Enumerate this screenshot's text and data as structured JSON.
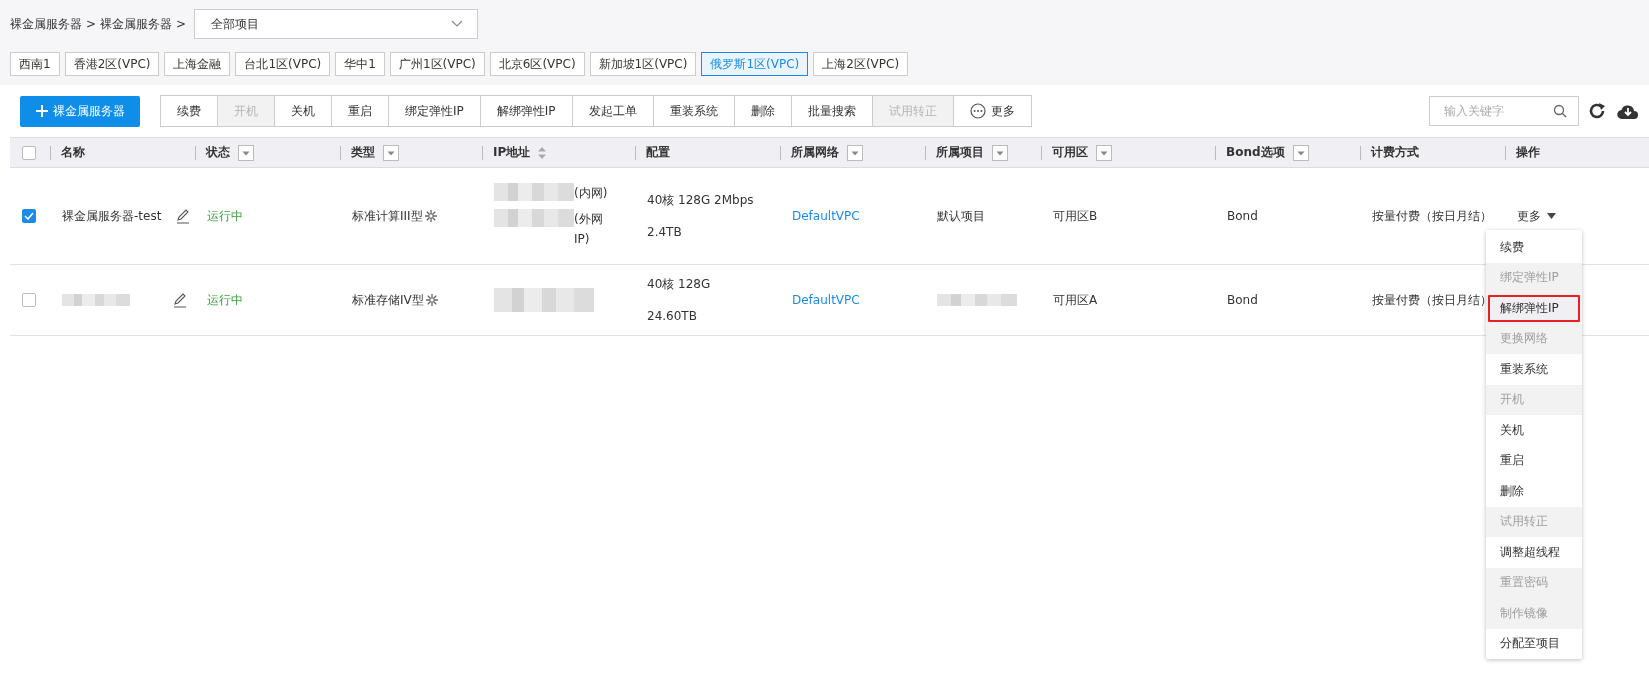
{
  "breadcrumb": {
    "crumbs": [
      "裸金属服务器",
      "裸金属服务器"
    ],
    "separator": ">"
  },
  "project_select": {
    "value": "全部项目"
  },
  "regions": [
    {
      "label": "西南1",
      "selected": false
    },
    {
      "label": "香港2区(VPC)",
      "selected": false
    },
    {
      "label": "上海金融",
      "selected": false
    },
    {
      "label": "台北1区(VPC)",
      "selected": false
    },
    {
      "label": "华中1",
      "selected": false
    },
    {
      "label": "广州1区(VPC)",
      "selected": false
    },
    {
      "label": "北京6区(VPC)",
      "selected": false
    },
    {
      "label": "新加坡1区(VPC)",
      "selected": false
    },
    {
      "label": "俄罗斯1区(VPC)",
      "selected": true
    },
    {
      "label": "上海2区(VPC)",
      "selected": false
    }
  ],
  "add_button": "裸金属服务器",
  "toolbar": [
    {
      "label": "续费",
      "disabled": false,
      "kind": "plain"
    },
    {
      "label": "开机",
      "disabled": true,
      "kind": "plain"
    },
    {
      "label": "关机",
      "disabled": false,
      "kind": "plain"
    },
    {
      "label": "重启",
      "disabled": false,
      "kind": "plain"
    },
    {
      "label": "绑定弹性IP",
      "disabled": false,
      "kind": "plain"
    },
    {
      "label": "解绑弹性IP",
      "disabled": false,
      "kind": "plain"
    },
    {
      "label": "发起工单",
      "disabled": false,
      "kind": "plain"
    },
    {
      "label": "重装系统",
      "disabled": false,
      "kind": "plain"
    },
    {
      "label": "删除",
      "disabled": false,
      "kind": "plain"
    },
    {
      "label": "批量搜索",
      "disabled": false,
      "kind": "plain"
    },
    {
      "label": "试用转正",
      "disabled": true,
      "kind": "plain"
    },
    {
      "label": "更多",
      "disabled": false,
      "kind": "more"
    }
  ],
  "search": {
    "placeholder": "输入关键字"
  },
  "table": {
    "header_checked": false,
    "columns": [
      {
        "label": "名称",
        "kind": "plain"
      },
      {
        "label": "状态",
        "kind": "filter"
      },
      {
        "label": "类型",
        "kind": "filter"
      },
      {
        "label": "IP地址",
        "kind": "sort"
      },
      {
        "label": "配置",
        "kind": "plain"
      },
      {
        "label": "所属网络",
        "kind": "filter"
      },
      {
        "label": "所属项目",
        "kind": "filter"
      },
      {
        "label": "可用区",
        "kind": "filter"
      },
      {
        "label": "Bond选项",
        "kind": "filter"
      },
      {
        "label": "计费方式",
        "kind": "plain"
      },
      {
        "label": "操作",
        "kind": "plain"
      }
    ],
    "rows": [
      {
        "checked": true,
        "name": {
          "text": "裸金属服务器-test",
          "redacted": false
        },
        "status": {
          "text": "运行中",
          "kind": "running"
        },
        "type": "标准计算III型",
        "ip": [
          {
            "redacted": true,
            "suffix": "(内网)"
          },
          {
            "redacted": true,
            "suffix": "(外网IP)"
          }
        ],
        "config": [
          "40核 128G 2Mbps",
          "2.4TB"
        ],
        "network": "DefaultVPC",
        "project": {
          "text": "默认项目",
          "redacted": false
        },
        "zone": "可用区B",
        "bond": "Bond",
        "billing": "按量付费（按日月结）",
        "action": "更多"
      },
      {
        "checked": false,
        "name": {
          "redacted": true
        },
        "status": {
          "text": "运行中",
          "kind": "running"
        },
        "type": "标准存储IV型",
        "ip": [
          {
            "redacted": true
          }
        ],
        "config": [
          "40核 128G",
          "24.60TB"
        ],
        "network": "DefaultVPC",
        "project": {
          "redacted": true
        },
        "zone": "可用区A",
        "bond": "Bond",
        "billing": "按量付费（按日月结）"
      }
    ]
  },
  "menu": {
    "items": [
      {
        "label": "续费",
        "disabled": false,
        "highlighted": false
      },
      {
        "label": "绑定弹性IP",
        "disabled": true,
        "highlighted": false
      },
      {
        "label": "解绑弹性IP",
        "disabled": false,
        "highlighted": true
      },
      {
        "label": "更换网络",
        "disabled": true,
        "highlighted": false
      },
      {
        "label": "重装系统",
        "disabled": false,
        "highlighted": false
      },
      {
        "label": "开机",
        "disabled": true,
        "highlighted": false
      },
      {
        "label": "关机",
        "disabled": false,
        "highlighted": false
      },
      {
        "label": "重启",
        "disabled": false,
        "highlighted": false
      },
      {
        "label": "删除",
        "disabled": false,
        "highlighted": false
      },
      {
        "label": "试用转正",
        "disabled": true,
        "highlighted": false
      },
      {
        "label": "调整超线程",
        "disabled": false,
        "highlighted": false
      },
      {
        "label": "重置密码",
        "disabled": true,
        "highlighted": false
      },
      {
        "label": "制作镜像",
        "disabled": true,
        "highlighted": false
      },
      {
        "label": "分配至项目",
        "disabled": false,
        "highlighted": false
      }
    ]
  }
}
